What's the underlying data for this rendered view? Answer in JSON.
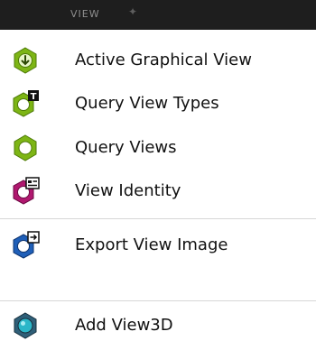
{
  "header": {
    "title": "VIEW",
    "pin_icon": "pin-icon"
  },
  "menu": {
    "items": [
      {
        "label": "Active Graphical View",
        "icon": "active-graphical-view-icon",
        "color": "#7db515",
        "badge": "arrow-down"
      },
      {
        "label": "Query View Types",
        "icon": "query-view-types-icon",
        "color": "#7db515",
        "badge": "T"
      },
      {
        "label": "Query Views",
        "icon": "query-views-icon",
        "color": "#7db515",
        "badge": ""
      },
      {
        "label": "View Identity",
        "icon": "view-identity-icon",
        "color": "#b0186f",
        "badge": "id-card"
      },
      {
        "label": "Export View Image",
        "icon": "export-view-image-icon",
        "color": "#1f5fb8",
        "badge": "export"
      },
      {
        "label": "Add View3D",
        "icon": "add-view3d-icon",
        "color": "#2f5f78",
        "badge": ""
      }
    ]
  }
}
